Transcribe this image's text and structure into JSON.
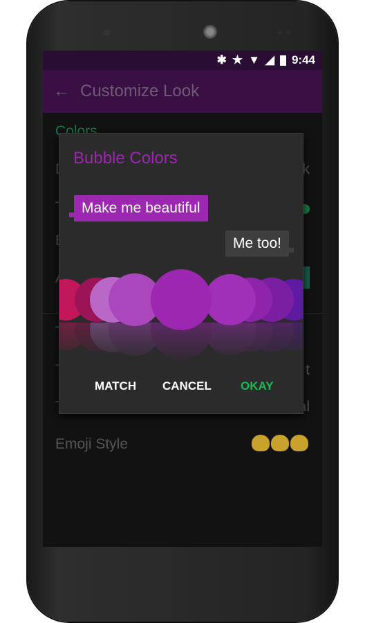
{
  "status": {
    "time": "9:44",
    "icons": [
      "bluetooth-icon",
      "star-icon",
      "wifi-icon",
      "signal-icon",
      "battery-icon"
    ]
  },
  "appbar": {
    "title": "Customize Look",
    "back_icon": "arrow-left-icon"
  },
  "background": {
    "section1": "Colors",
    "row1a": "D",
    "row1b": "k",
    "row2": "T",
    "row3": "B",
    "row4": "A",
    "section2": "T",
    "row5a": "T",
    "row5b": "t",
    "row6a": "T",
    "row6b": "al",
    "emoji_label": "Emoji Style"
  },
  "dialog": {
    "title": "Bubble Colors",
    "incoming": "Make me beautiful",
    "outgoing": "Me too!",
    "colors": [
      "#c2185b",
      "#9c1458",
      "#ba68c8",
      "#ab47bc",
      "#9c27b0",
      "#a030b8",
      "#8e24aa",
      "#7b1fa2",
      "#5e1aa0"
    ],
    "selected": "#9c27b0",
    "match": "MATCH",
    "cancel": "CANCEL",
    "okay": "OKAY"
  },
  "accent": {
    "purple": "#9c27b0",
    "green": "#1db954"
  }
}
